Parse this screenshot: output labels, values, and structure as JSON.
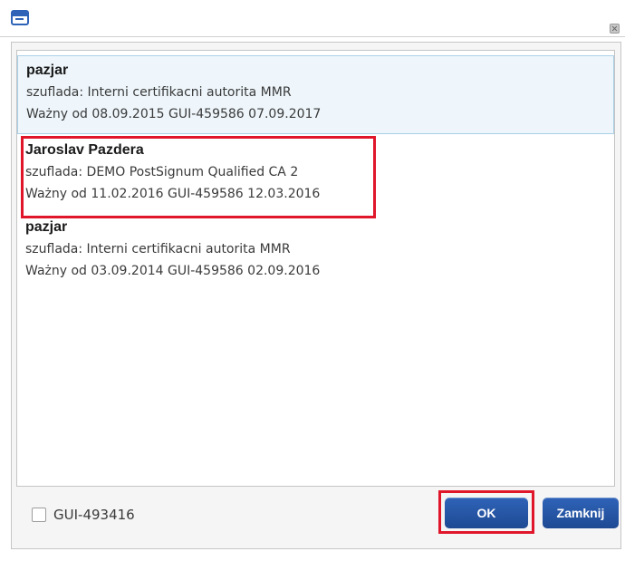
{
  "window": {
    "icon": "window-icon",
    "close_icon": "close-icon"
  },
  "certificates": [
    {
      "name": "pazjar",
      "store": "szuflada: Interni certifikacni autorita MMR",
      "validity": "Ważny od 08.09.2015 GUI-459586 07.09.2017",
      "hovered": true
    },
    {
      "name": "Jaroslav Pazdera",
      "store": "szuflada: DEMO PostSignum Qualified CA 2",
      "validity": "Ważny od 11.02.2016 GUI-459586 12.03.2016",
      "highlighted_annotation": true
    },
    {
      "name": "pazjar",
      "store": "szuflada: Interni certifikacni autorita MMR",
      "validity": "Ważny od 03.09.2014 GUI-459586 02.09.2016"
    }
  ],
  "footer": {
    "checkbox_label": "GUI-493416",
    "checkbox_checked": false,
    "ok_label": "OK",
    "close_label": "Zamknij"
  },
  "colors": {
    "button_blue": "#2f63b8",
    "annotation_red": "#e0162b",
    "hover_highlight": "#eef6fb"
  }
}
